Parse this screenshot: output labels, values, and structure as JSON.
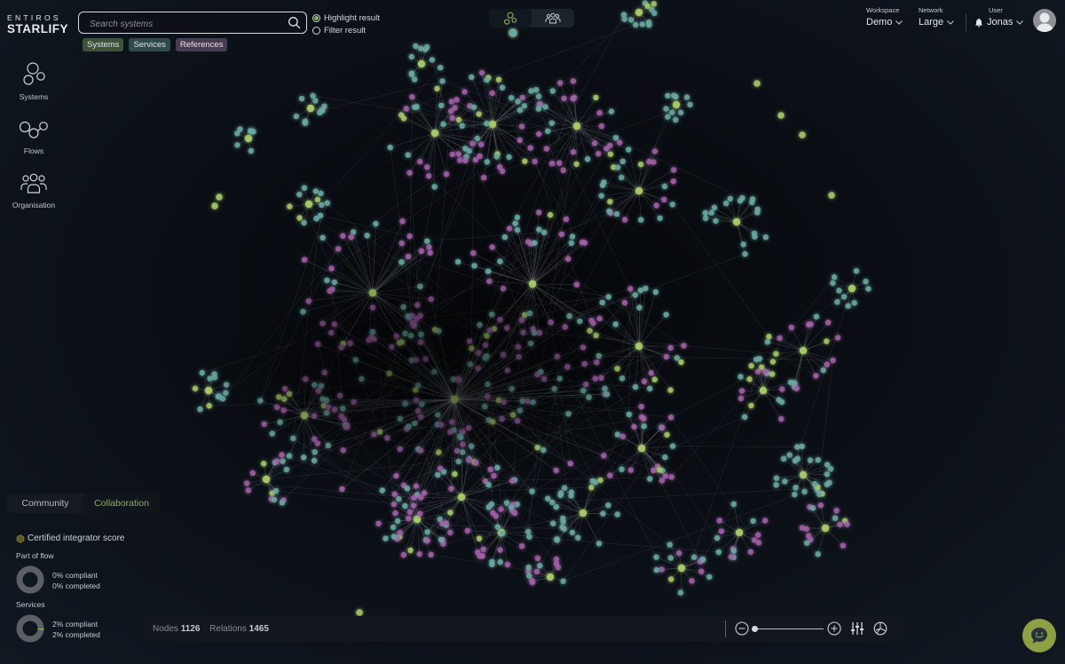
{
  "app": {
    "logo_top": "ENTIROS",
    "logo_bottom": "STARLIFY"
  },
  "search": {
    "placeholder": "Search systems",
    "value": "",
    "icon": "search-icon"
  },
  "result_mode": {
    "options": [
      {
        "label": "Highlight result",
        "selected": true
      },
      {
        "label": "Filter result",
        "selected": false
      }
    ]
  },
  "filter_chips": [
    {
      "label": "Systems",
      "color": "#3d5238"
    },
    {
      "label": "Services",
      "color": "#2f4a4a"
    },
    {
      "label": "References",
      "color": "#4a3a52"
    }
  ],
  "view_toggle": {
    "options": [
      {
        "name": "network-view",
        "icon": "network-icon",
        "active": true
      },
      {
        "name": "organisation-view",
        "icon": "people-icon",
        "active": false
      }
    ]
  },
  "header": {
    "workspace": {
      "label": "Workspace",
      "value": "Demo"
    },
    "network": {
      "label": "Network",
      "value": "Large"
    },
    "user": {
      "label": "User",
      "value": "Jonas"
    }
  },
  "nav": {
    "items": [
      {
        "label": "Systems",
        "icon": "systems-icon"
      },
      {
        "label": "Flows",
        "icon": "flows-icon"
      },
      {
        "label": "Organisation",
        "icon": "organisation-icon"
      }
    ]
  },
  "score_panel": {
    "tabs": [
      {
        "label": "Community",
        "active": false
      },
      {
        "label": "Collaboration",
        "active": true
      }
    ],
    "title": "Certified integrator score",
    "part_of_flow": {
      "label": "Part of flow",
      "compliant": "0% compliant",
      "completed": "0% completed",
      "compliant_pct": 0
    },
    "services": {
      "label": "Services",
      "compliant": "2% compliant",
      "completed": "2% completed",
      "compliant_pct": 2
    }
  },
  "stats": {
    "nodes_label": "Nodes",
    "nodes_value": "1126",
    "relations_label": "Relations",
    "relations_value": "1465"
  },
  "zoom": {
    "level_fraction": 0.02
  },
  "colors": {
    "system": "#a6c86a",
    "service": "#6aa8a2",
    "reference": "#a260a8",
    "edge": "#9aa0a6",
    "accent": "#8ea045"
  }
}
